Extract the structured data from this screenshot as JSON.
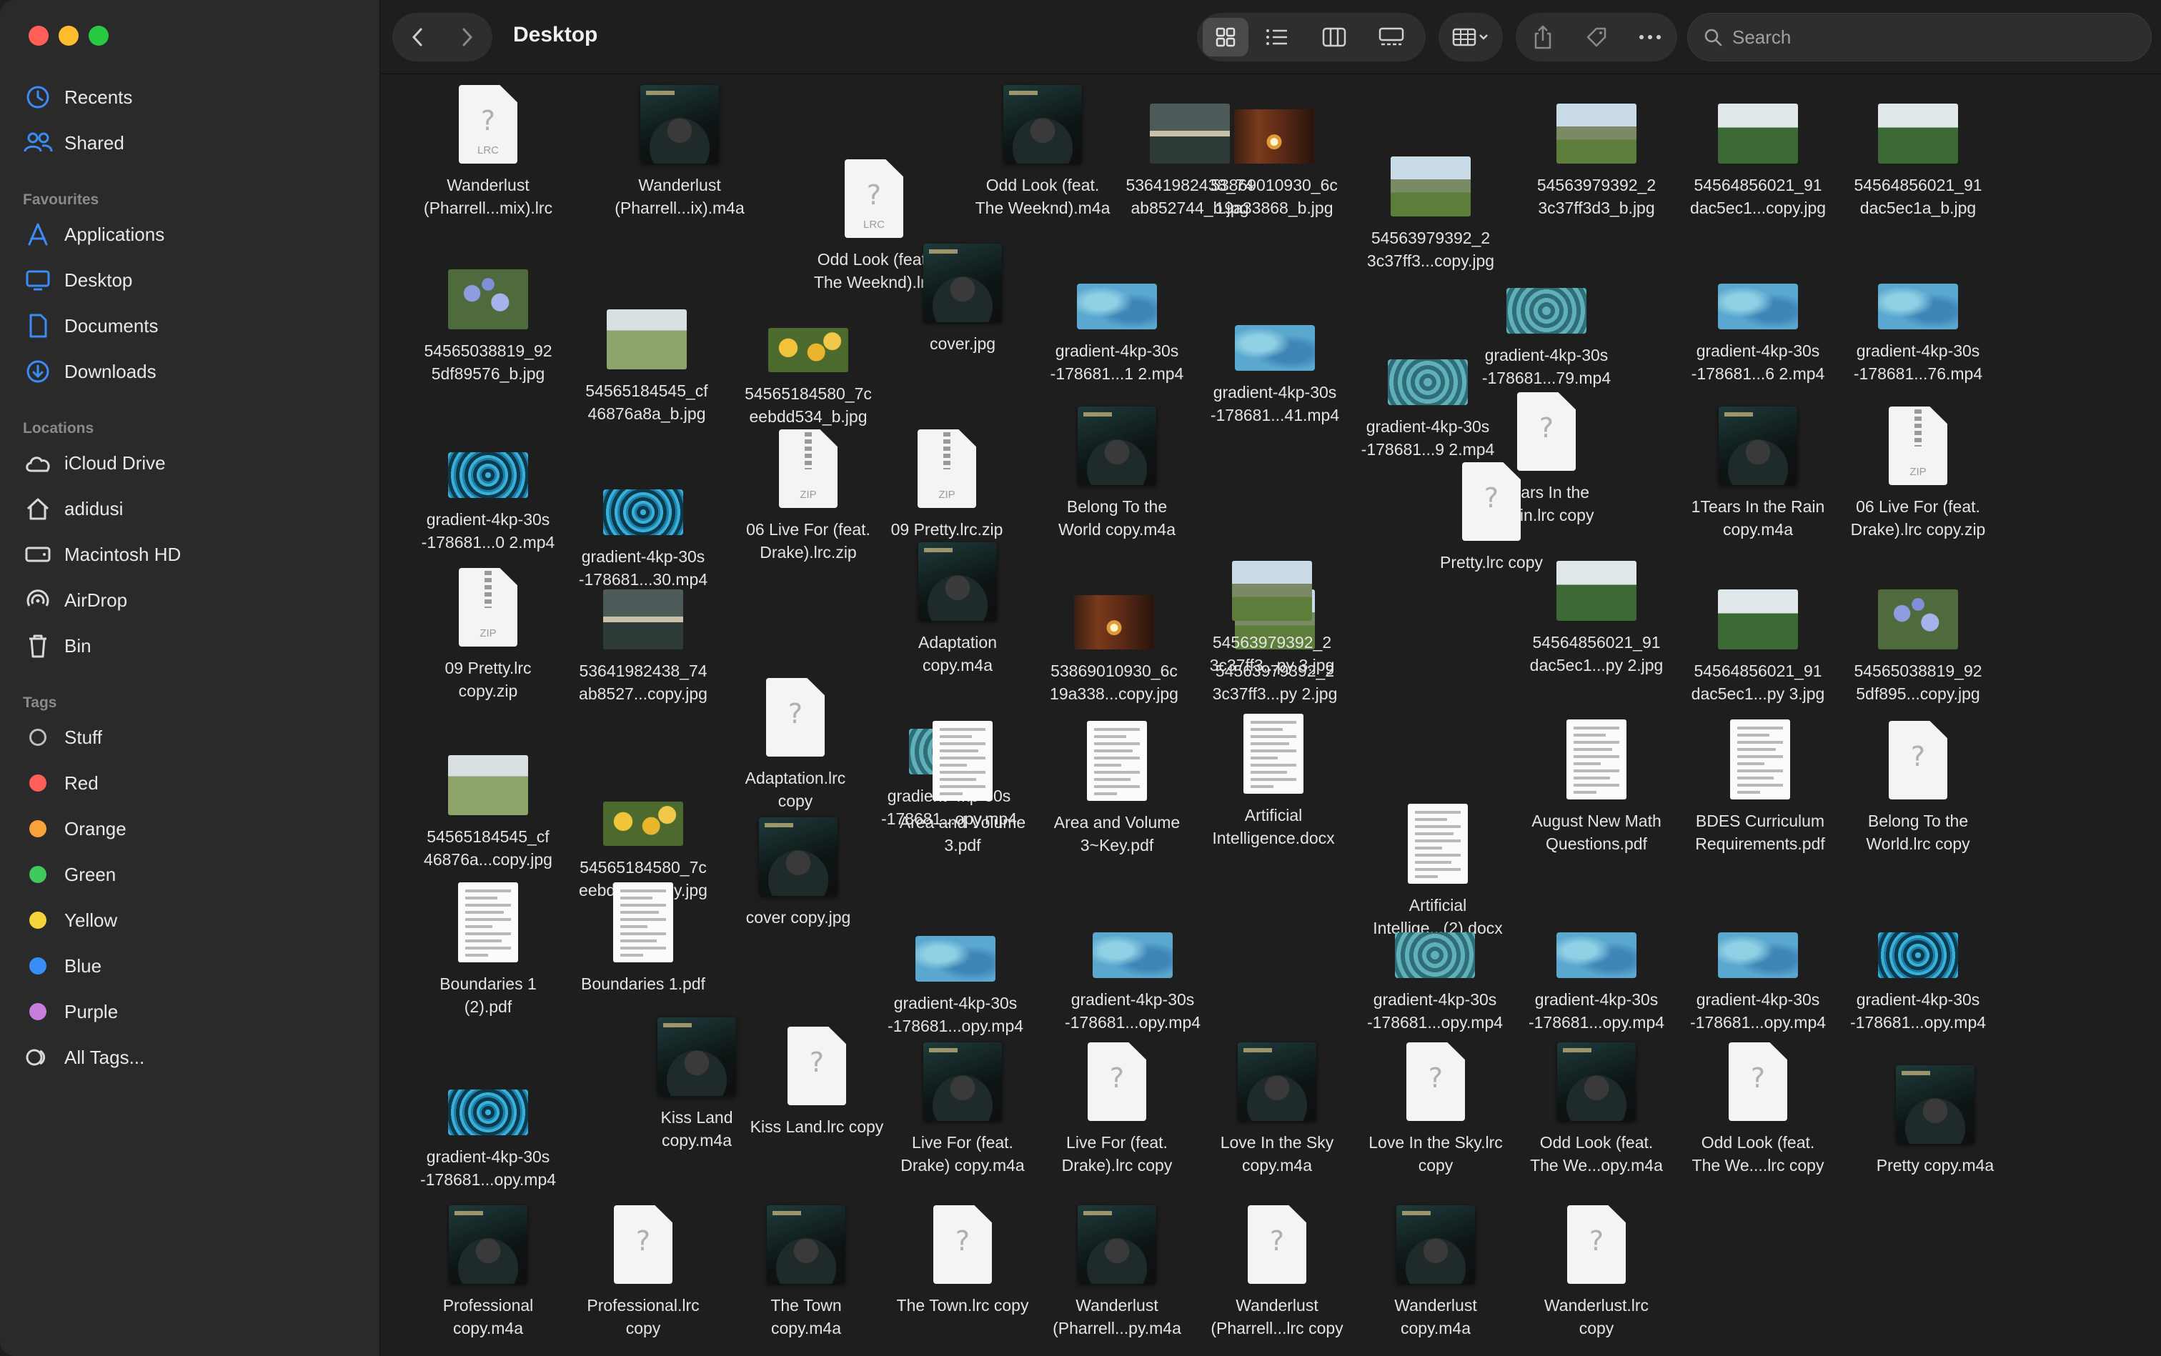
{
  "window": {
    "title": "Desktop",
    "search_placeholder": "Search"
  },
  "sidebar": {
    "recents": "Recents",
    "shared": "Shared",
    "favourites_heading": "Favourites",
    "favourites": [
      "Applications",
      "Desktop",
      "Documents",
      "Downloads"
    ],
    "locations_heading": "Locations",
    "locations": [
      "iCloud Drive",
      "adidusi",
      "Macintosh HD",
      "AirDrop",
      "Bin"
    ],
    "tags_heading": "Tags",
    "tags": [
      {
        "label": "Stuff",
        "color": "outline"
      },
      {
        "label": "Red",
        "color": "#ff5f57"
      },
      {
        "label": "Orange",
        "color": "#f7a33a"
      },
      {
        "label": "Green",
        "color": "#3ec95a"
      },
      {
        "label": "Yellow",
        "color": "#f7d33a"
      },
      {
        "label": "Blue",
        "color": "#3a8cf7"
      },
      {
        "label": "Purple",
        "color": "#c77ddb"
      }
    ],
    "all_tags": "All Tags..."
  },
  "files": [
    {
      "name": "Wanderlust\n(Pharrell...mix).lrc",
      "kind": "lrc"
    },
    {
      "name": "Wanderlust\n(Pharrell...ix).m4a",
      "kind": "album"
    },
    {
      "name": "Odd Look (feat.\nThe Weeknd).lrc",
      "kind": "lrc"
    },
    {
      "name": "Odd Look (feat.\nThe Weeknd).m4a",
      "kind": "album"
    },
    {
      "name": "53641982438_74\nab852744_b.jpg",
      "kind": "sunset"
    },
    {
      "name": "53869010930_6c\n19a33868_b.jpg",
      "kind": "orange"
    },
    {
      "name": "54563979392_2\n3c37ff3...copy.jpg",
      "kind": "rock"
    },
    {
      "name": "54563979392_2\n3c37ff3d3_b.jpg",
      "kind": "rock"
    },
    {
      "name": "54564856021_91\ndac5ec1...copy.jpg",
      "kind": "tree"
    },
    {
      "name": "54564856021_91\ndac5ec1a_b.jpg",
      "kind": "tree"
    },
    {
      "name": "54565038819_92\n5df89576_b.jpg",
      "kind": "flower"
    },
    {
      "name": "54565184545_cf\n46876a8a_b.jpg",
      "kind": "field"
    },
    {
      "name": "54565184580_7c\neebdd534_b.jpg",
      "kind": "yellow"
    },
    {
      "name": "cover.jpg",
      "kind": "album"
    },
    {
      "name": "gradient-4kp-30s\n-178681...1 2.mp4",
      "kind": "blue"
    },
    {
      "name": "gradient-4kp-30s\n-178681...41.mp4",
      "kind": "blue"
    },
    {
      "name": "gradient-4kp-30s\n-178681...79.mp4",
      "kind": "teal"
    },
    {
      "name": "gradient-4kp-30s\n-178681...9 2.mp4",
      "kind": "teal"
    },
    {
      "name": "gradient-4kp-30s\n-178681...6 2.mp4",
      "kind": "blue"
    },
    {
      "name": "gradient-4kp-30s\n-178681...76.mp4",
      "kind": "blue"
    },
    {
      "name": "gradient-4kp-30s\n-178681...0 2.mp4",
      "kind": "tunnel"
    },
    {
      "name": "gradient-4kp-30s\n-178681...30.mp4",
      "kind": "tunnel"
    },
    {
      "name": "06 Live For (feat.\nDrake).lrc.zip",
      "kind": "zip"
    },
    {
      "name": "09 Pretty.lrc.zip",
      "kind": "zip"
    },
    {
      "name": "Belong To the\nWorld copy.m4a",
      "kind": "album"
    },
    {
      "name": "Tears In the\nRain.lrc copy",
      "kind": "lrc"
    },
    {
      "name": "Pretty.lrc copy",
      "kind": "lrc"
    },
    {
      "name": "1Tears In the Rain\ncopy.m4a",
      "kind": "album"
    },
    {
      "name": "06 Live For (feat.\nDrake).lrc copy.zip",
      "kind": "zip"
    },
    {
      "name": "09 Pretty.lrc\ncopy.zip",
      "kind": "zip"
    },
    {
      "name": "53641982438_74\nab8527...copy.jpg",
      "kind": "sunset"
    },
    {
      "name": "Adaptation\ncopy.m4a",
      "kind": "album"
    },
    {
      "name": "53869010930_6c\n19a338...copy.jpg",
      "kind": "orange"
    },
    {
      "name": "54563979392_2\n3c37ff3...py 2.jpg",
      "kind": "rock"
    },
    {
      "name": "54563979392_2\n3c37ff3...py 3.jpg",
      "kind": "rock"
    },
    {
      "name": "54564856021_91\ndac5ec1...py 2.jpg",
      "kind": "tree"
    },
    {
      "name": "54564856021_91\ndac5ec1...py 3.jpg",
      "kind": "tree"
    },
    {
      "name": "54565038819_92\n5df895...copy.jpg",
      "kind": "flower"
    },
    {
      "name": "54565184545_cf\n46876a...copy.jpg",
      "kind": "field"
    },
    {
      "name": "54565184580_7c\neebdd5...copy.jpg",
      "kind": "yellow"
    },
    {
      "name": "Adaptation.lrc\ncopy",
      "kind": "lrc"
    },
    {
      "name": "gradient-4kp-30s\n-178681...opy.mp4",
      "kind": "teal"
    },
    {
      "name": "Area and Volume\n3.pdf",
      "kind": "pdf"
    },
    {
      "name": "Area and Volume\n3~Key.pdf",
      "kind": "pdf"
    },
    {
      "name": "Artificial\nIntelligence.docx",
      "kind": "pdf"
    },
    {
      "name": "Artificial\nIntellige...(2).docx",
      "kind": "pdf"
    },
    {
      "name": "August New Math\nQuestions.pdf",
      "kind": "pdf"
    },
    {
      "name": "BDES Curriculum\nRequirements.pdf",
      "kind": "pdf"
    },
    {
      "name": "Belong To the\nWorld.lrc copy",
      "kind": "lrc"
    },
    {
      "name": "cover copy.jpg",
      "kind": "album"
    },
    {
      "name": "Boundaries 1\n(2).pdf",
      "kind": "pdf"
    },
    {
      "name": "Boundaries 1.pdf",
      "kind": "pdf"
    },
    {
      "name": "gradient-4kp-30s\n-178681...opy.mp4",
      "kind": "blue"
    },
    {
      "name": "gradient-4kp-30s\n-178681...opy.mp4",
      "kind": "blue"
    },
    {
      "name": "gradient-4kp-30s\n-178681...opy.mp4",
      "kind": "teal"
    },
    {
      "name": "gradient-4kp-30s\n-178681...opy.mp4",
      "kind": "blue"
    },
    {
      "name": "gradient-4kp-30s\n-178681...opy.mp4",
      "kind": "blue"
    },
    {
      "name": "gradient-4kp-30s\n-178681...opy.mp4",
      "kind": "tunnel"
    },
    {
      "name": "Kiss Land\ncopy.m4a",
      "kind": "album"
    },
    {
      "name": "Kiss Land.lrc copy",
      "kind": "lrc"
    },
    {
      "name": "gradient-4kp-30s\n-178681...opy.mp4",
      "kind": "tunnel"
    },
    {
      "name": "Live For (feat.\nDrake) copy.m4a",
      "kind": "album"
    },
    {
      "name": "Live For (feat.\nDrake).lrc copy",
      "kind": "lrc"
    },
    {
      "name": "Love In the Sky\ncopy.m4a",
      "kind": "album"
    },
    {
      "name": "Love In the Sky.lrc\ncopy",
      "kind": "lrc"
    },
    {
      "name": "Odd Look (feat.\nThe We...opy.m4a",
      "kind": "album"
    },
    {
      "name": "Odd Look (feat.\nThe We....lrc copy",
      "kind": "lrc"
    },
    {
      "name": "Pretty copy.m4a",
      "kind": "album"
    },
    {
      "name": "Professional\ncopy.m4a",
      "kind": "album"
    },
    {
      "name": "Professional.lrc\ncopy",
      "kind": "lrc"
    },
    {
      "name": "The Town\ncopy.m4a",
      "kind": "album"
    },
    {
      "name": "The Town.lrc copy",
      "kind": "lrc"
    },
    {
      "name": "Wanderlust\n(Pharrell...py.m4a",
      "kind": "album"
    },
    {
      "name": "Wanderlust\n(Pharrell...lrc copy",
      "kind": "lrc"
    },
    {
      "name": "Wanderlust\ncopy.m4a",
      "kind": "album"
    },
    {
      "name": "Wanderlust.lrc\ncopy",
      "kind": "lrc"
    }
  ]
}
